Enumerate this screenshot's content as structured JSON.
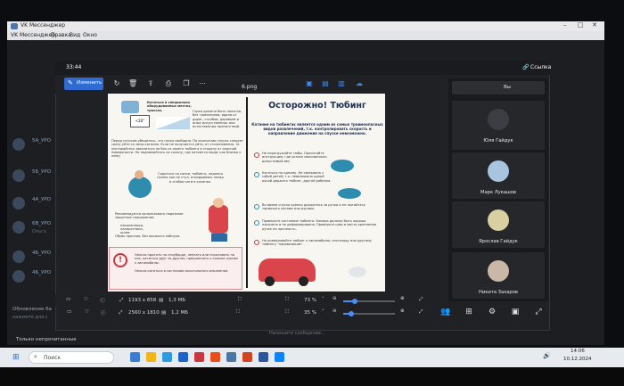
{
  "vk": {
    "title": "VK Мессенджер",
    "menu": [
      "VK Мессенджер",
      "Правка",
      "Вид",
      "Окно"
    ],
    "chats": [
      {
        "name": "5А_УРО",
        "sub": ""
      },
      {
        "name": "5Б_УРО",
        "sub": ""
      },
      {
        "name": "4А_УРО",
        "sub": ""
      },
      {
        "name": "6В_УРО",
        "sub": "Ольга"
      },
      {
        "name": "4Б_УРО",
        "sub": ""
      },
      {
        "name": "Обновление ба",
        "sub": "нажмите для с"
      }
    ],
    "unread_filter": "Только непрочитанные",
    "notify_hint": "Напишите сообщение..."
  },
  "call": {
    "timer": "33:44",
    "link_label": "Ссылка",
    "tab_label": "Вы",
    "participants": [
      {
        "name": "Юля Гайдук"
      },
      {
        "name": "Марк Лукашов"
      },
      {
        "name": "Ярослав Гайдук"
      },
      {
        "name": "Никита Захаров"
      }
    ]
  },
  "viewer": {
    "edit_label": "Изменить",
    "filename": "6.png",
    "info1": {
      "dims": "1193 x 858",
      "size": "1,3 МБ",
      "zoom": "73 %"
    },
    "info2": {
      "dims": "2560 x 1810",
      "size": "1,2 МБ",
      "zoom": "35 %"
    }
  },
  "doc": {
    "title": "Осторожно! Тюбинг",
    "subtitle": "Катание на тюбингах является одним из самых травмоопасных видов развлечений, т.к. контролировать скорость и направление движения на спуске невозможно.",
    "left_top_1": "Кататься в специально оборудованных местах, трассах.",
    "left_top_2": "Горка должна быть пологая, без трамплинов, вдали от дорог, столбов, деревьев и иных искусственных или естественных препятствий.",
    "sign_label": "<20°",
    "left_para": "Перед спуском убедитесь, что горка свободна. По окончании спуска следует сразу уйти со зоны катания. Если не получается уйти, от столкновения, то постарайтесь завалиться на бок со своего тюбинга в сторону от опасной поверхности. Не поднимайтесь по склону, где катаются люди, как близко к нему.",
    "left_mid": "Садиться на санки, тюбинги, ледянки нужно как на стул, откидываясь назад и сгибая ноги в коленях.",
    "protect_title": "Рекомендуется использовать надежное защитное снаряжение:",
    "protect_items": [
      "наколенники,",
      "налокотники,",
      "шлем"
    ],
    "shoes": "Обувь прочная, без высокого каблука.",
    "warn_items": [
      "Нельзя прыгать на сноуборде, ленкать или спрыгивать на них, кататься друг за другом, прикреплять к санкам тросом к автомобилю.",
      "Нельзя кататься в состоянии алкогольного опьянения."
    ],
    "right_items": [
      "Не перегружайте тюбы. Прочитайте инструкцию, где указан максимально допустимый вес.",
      "Кататься по одному. Не связывать с собой детей, т.к. невозможно одной рукой держать тюбинг, другой ребенка.",
      "Во время спуска крепко держитесь за ручки и не пытайтесь тормозить ногами или руками.",
      "Проверьте состояние тюбинга. Камера должна быть хорошо накачена и не деформирована. Проверьте швы и место крепления ручек на прочность.",
      "Не привязывайте тюбинг к автомобилю, снегоходу или другому тюбингу \"паровозиком\"."
    ]
  },
  "taskbar": {
    "search_label": "Поиск",
    "clock_time": "14:06",
    "clock_date": "10.12.2024"
  },
  "colors": {
    "accent": "#2f6bd1",
    "doc_title": "#1f2f4f",
    "warning_red": "#c9363f",
    "tube_blue": "#2e8cae"
  }
}
